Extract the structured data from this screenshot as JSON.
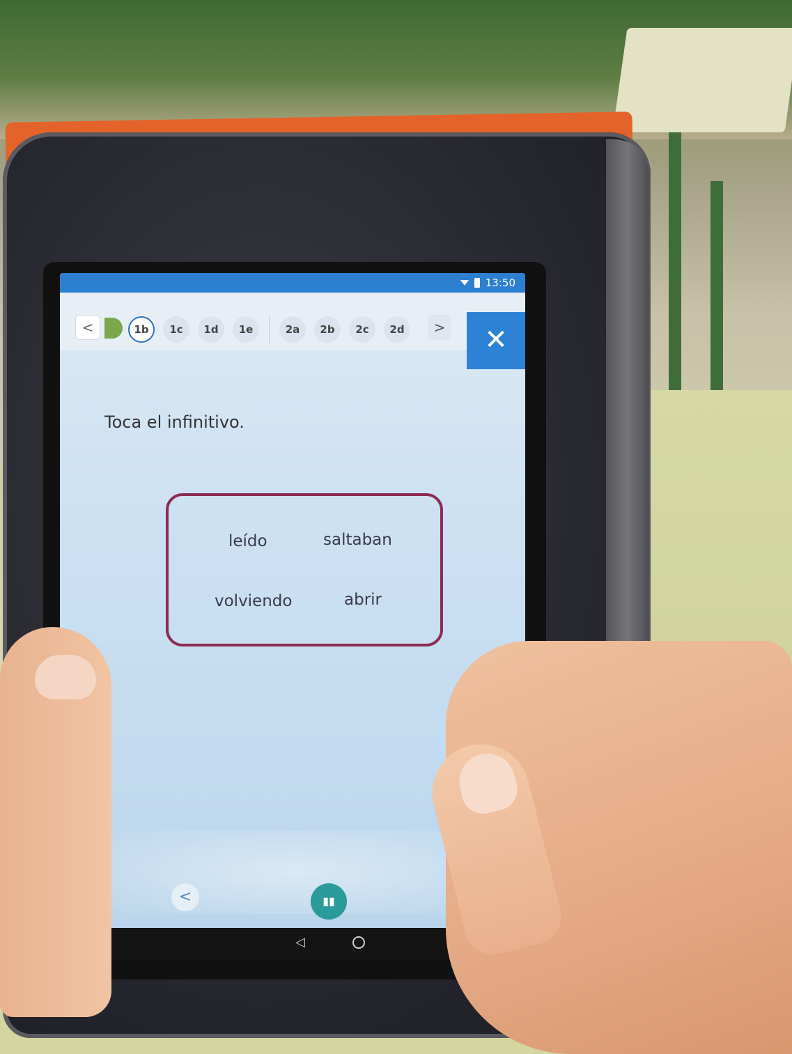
{
  "status_bar": {
    "time": "13:50"
  },
  "toolbar": {
    "back_label": "<",
    "chips_group1": [
      "1b",
      "1c",
      "1d",
      "1e"
    ],
    "chips_group2": [
      "2a",
      "2b",
      "2c",
      "2d"
    ],
    "forward_label": ">",
    "close_label": "✕"
  },
  "exercise": {
    "instruction": "Toca el infinitivo.",
    "options": [
      "leído",
      "saltaban",
      "volviendo",
      "abrir"
    ]
  },
  "bottom_nav": {
    "prev_label": "<",
    "play_label": "▮▮",
    "next_label": ">"
  },
  "colors": {
    "accent": "#2d82d6",
    "option_border": "#8e2b54",
    "done": "#7aa84a"
  },
  "icons": [
    "wifi-icon",
    "battery-icon",
    "close-icon",
    "chevron-left-icon",
    "chevron-right-icon",
    "pause-icon",
    "android-back-icon",
    "android-home-icon"
  ]
}
